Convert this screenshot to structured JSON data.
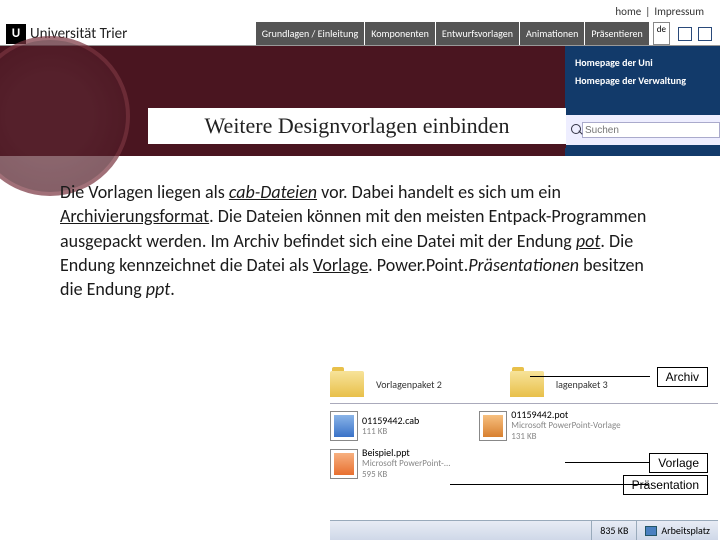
{
  "topnav": {
    "home": "home",
    "sep": "|",
    "impressum": "Impressum"
  },
  "logo": {
    "letter": "U",
    "text": "Universität Trier"
  },
  "tabs": [
    "Grundlagen / Einleitung",
    "Komponenten",
    "Entwurfsvorlagen",
    "Animationen",
    "Präsentieren"
  ],
  "lang": "de",
  "darkright": {
    "l1": "Homepage der Uni",
    "l2": "Homepage der Verwaltung"
  },
  "title": "Weitere Designvorlagen einbinden",
  "search": {
    "placeholder": "Suchen"
  },
  "body": {
    "t1": "Die Vorlagen liegen als ",
    "u1": "cab-Dateien",
    "t2": " vor. Dabei handelt es sich um ein ",
    "u2": "Archivierungsformat",
    "t3": ". Die Dateien können mit den meisten Entpack-Programmen ausgepackt werden. Im Archiv befindet sich eine Datei mit der Endung ",
    "u3": "pot",
    "t4": ". Die Endung kennzeichnet die Datei als ",
    "u4": "Vorlage",
    "t5": ". Power.Point.",
    "i1": "Präsentationen",
    "t6": " besitzen die Endung ",
    "i2": "ppt",
    "t7": "."
  },
  "explorer": {
    "folder1": "Vorlagenpaket 2",
    "folder2": "lagenpaket 3",
    "cab_name": "01159442.cab",
    "cab_size": "111 KB",
    "pot_name": "01159442.pot",
    "pot_sub": "Microsoft PowerPoint-Vorlage",
    "pot_size": "131 KB",
    "ppt_name": "Beispiel.ppt",
    "ppt_sub": "Microsoft PowerPoint-...",
    "ppt_size": "595 KB",
    "callout_archiv": "Archiv",
    "callout_vorlage": "Vorlage",
    "callout_praes": "Präsentation",
    "status_size": "835 KB",
    "status_loc": "Arbeitsplatz"
  }
}
